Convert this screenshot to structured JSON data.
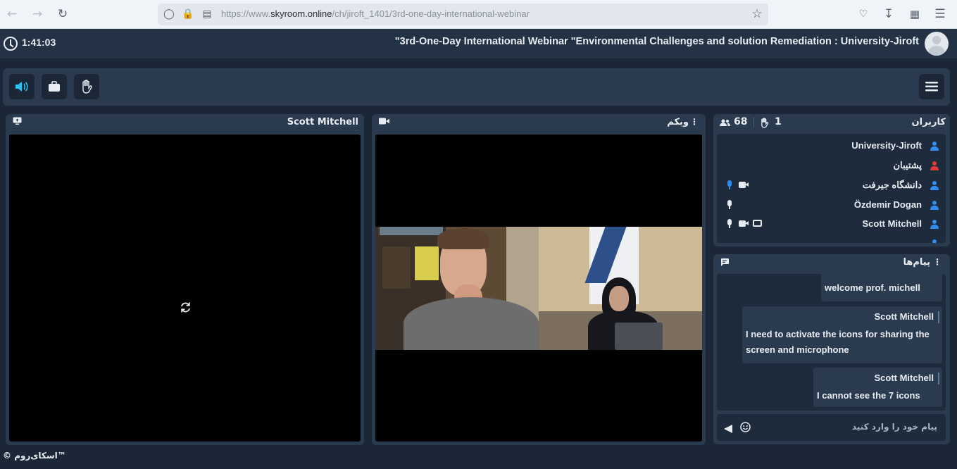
{
  "browser": {
    "back_icon": "arrow-left",
    "forward_icon": "arrow-right",
    "reload_icon": "reload",
    "url_prefix": "https://www.",
    "url_domain": "skyroom.online",
    "url_path": "/ch/jiroft_1401/3rd-one-day-international-webinar",
    "bookmark_icon": "star",
    "pocket_icon": "pocket",
    "download_icon": "download",
    "extensions_icon": "puzzle",
    "menu_icon": "hamburger"
  },
  "header": {
    "timer": "1:41:03",
    "title": "\"3rd-One-Day International Webinar \"Environmental Challenges and solution Remediation : University-Jiroft"
  },
  "toolbar": {
    "audio_icon": "speaker",
    "share_icon": "briefcase",
    "hand_icon": "hand",
    "menu_icon": "hamburger"
  },
  "screen_panel": {
    "title": "Scott Mitchell",
    "loading_icon": "sync"
  },
  "webcam_panel": {
    "title": "وبکم"
  },
  "users_panel": {
    "title": "کاربران",
    "user_count": "68",
    "hand_count": "1",
    "users": [
      {
        "name": "University-Jiroft",
        "color": "#2f8df0",
        "mic": false,
        "cam": false,
        "screen": false
      },
      {
        "name": "پشتیبان",
        "color": "#e53935",
        "mic": false,
        "cam": false,
        "screen": false
      },
      {
        "name": "دانشگاه جیرفت",
        "color": "#2f8df0",
        "mic": true,
        "mic_color": "#2f8df0",
        "cam": true,
        "screen": false
      },
      {
        "name": "Özdemir Dogan",
        "color": "#2f8df0",
        "mic": true,
        "mic_color": "#e8edf3",
        "cam": false,
        "screen": false
      },
      {
        "name": "Scott Mitchell",
        "color": "#2f8df0",
        "mic": true,
        "mic_color": "#e8edf3",
        "cam": true,
        "screen": true
      }
    ]
  },
  "chat_panel": {
    "title": "پیام‌ها",
    "messages": [
      {
        "sender": "",
        "text": "welcome prof. michell"
      },
      {
        "sender": "Scott Mitchell",
        "text": "I need to activate the icons for sharing the screen and microphone"
      },
      {
        "sender": "Scott Mitchell",
        "text": "I cannot see the 7 icons"
      }
    ],
    "input_placeholder": "پیام خود را وارد کنید"
  },
  "footer": {
    "brand": "© اسکای‌روم™"
  },
  "colors": {
    "background": "#1b2636",
    "panel": "#2a3a4f",
    "accent": "#2cc3ef",
    "user_blue": "#2f8df0",
    "user_red": "#e53935"
  }
}
